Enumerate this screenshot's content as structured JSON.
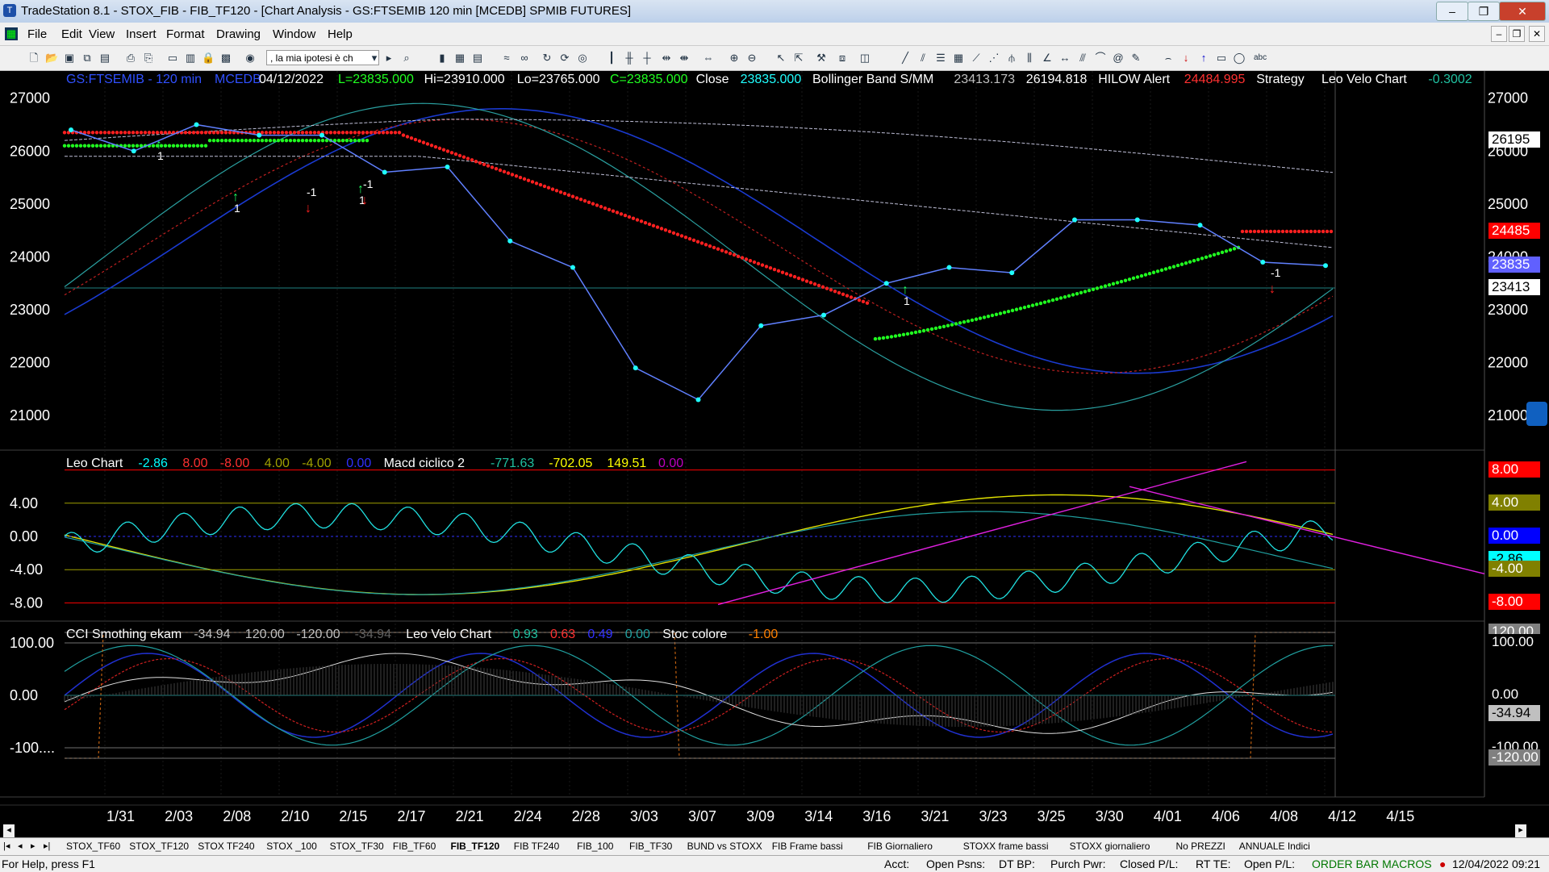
{
  "window": {
    "title": "TradeStation 8.1 - STOX_FIB - FIB_TF120 - [Chart Analysis - GS:FTSEMIB  120 min  [MCEDB] SPMIB FUTURES]",
    "minimize": "–",
    "restore": "❐",
    "close": "✕"
  },
  "menu": [
    "File",
    "Edit",
    "View",
    "Insert",
    "Format",
    "Drawing",
    "Window",
    "Help"
  ],
  "toolbar": {
    "combo_value": ", la mia ipotesi è ch"
  },
  "chart": {
    "header": {
      "symbol": "GS:FTSEMIB - 120 min",
      "feed": "MCEDB",
      "date": "04/12/2022",
      "last": "L=23835.000",
      "high": "Hi=23910.000",
      "low": "Lo=23765.000",
      "close_eq": "C=23835.000",
      "close_label": "Close",
      "close_value": "23835.000",
      "bb_label": "Bollinger Band S/MM",
      "bb_low": "23413.173",
      "bb_high": "26194.818",
      "hilow_label": "HILOW Alert",
      "hilow_value": "24484.995",
      "strategy_label": "Strategy",
      "velo_label": "Leo Velo Chart",
      "velo_value": "-0.3002"
    },
    "price_axis": [
      "27000",
      "26000",
      "25000",
      "24000",
      "23000",
      "22000",
      "21000"
    ],
    "price_badges": [
      {
        "text": "26195",
        "bg": "#ffffff",
        "fg": "#000000"
      },
      {
        "text": "24485",
        "bg": "#ff0000",
        "fg": "#ffffff"
      },
      {
        "text": "23835",
        "bg": "#6060ff",
        "fg": "#ffffff"
      },
      {
        "text": "23413",
        "bg": "#ffffff",
        "fg": "#000000"
      }
    ],
    "signals": [
      "1",
      "1",
      "-1",
      "1",
      "-1",
      "1",
      "-1"
    ],
    "dates": [
      "1/31",
      "2/03",
      "2/08",
      "2/10",
      "2/15",
      "2/17",
      "2/21",
      "2/24",
      "2/28",
      "3/03",
      "3/07",
      "3/09",
      "3/14",
      "3/16",
      "3/21",
      "3/23",
      "3/25",
      "3/30",
      "4/01",
      "4/06",
      "4/08",
      "4/12",
      "4/15"
    ]
  },
  "panel2": {
    "items": [
      {
        "text": "Leo Chart",
        "color": "#ffffff"
      },
      {
        "text": "-2.86",
        "color": "#00ffff"
      },
      {
        "text": "8.00",
        "color": "#ff3030"
      },
      {
        "text": "-8.00",
        "color": "#ff3030"
      },
      {
        "text": "4.00",
        "color": "#a0a000"
      },
      {
        "text": "-4.00",
        "color": "#a0a000"
      },
      {
        "text": "0.00",
        "color": "#3030ff"
      },
      {
        "text": "Macd ciclico 2",
        "color": "#ffffff"
      },
      {
        "text": "-771.63",
        "color": "#20c0a0"
      },
      {
        "text": "-702.05",
        "color": "#ffff00"
      },
      {
        "text": "149.51",
        "color": "#ffff00"
      },
      {
        "text": "0.00",
        "color": "#c000c0"
      }
    ],
    "axis": [
      "4.00",
      "0.00",
      "-4.00",
      "-8.00"
    ],
    "badges": [
      {
        "text": "8.00",
        "bg": "#ff0000",
        "fg": "#ffffff"
      },
      {
        "text": "4.00",
        "bg": "#808000",
        "fg": "#ffffff"
      },
      {
        "text": "0.00",
        "bg": "#0000ff",
        "fg": "#ffffff"
      },
      {
        "text": "-2.86",
        "bg": "#00ffff",
        "fg": "#000000"
      },
      {
        "text": "-4.00",
        "bg": "#808000",
        "fg": "#ffffff"
      },
      {
        "text": "-8.00",
        "bg": "#ff0000",
        "fg": "#ffffff"
      }
    ]
  },
  "panel3": {
    "items": [
      {
        "text": "CCI Smothing ekam",
        "color": "#ffffff"
      },
      {
        "text": "-34.94",
        "color": "#c0c0c0"
      },
      {
        "text": "120.00",
        "color": "#c0c0c0"
      },
      {
        "text": "-120.00",
        "color": "#c0c0c0"
      },
      {
        "text": "-34.94",
        "color": "#606060"
      },
      {
        "text": "Leo Velo Chart",
        "color": "#ffffff"
      },
      {
        "text": "0.93",
        "color": "#20c0a0"
      },
      {
        "text": "0.63",
        "color": "#ff3030"
      },
      {
        "text": "0.49",
        "color": "#3030ff"
      },
      {
        "text": "0.00",
        "color": "#20a0a0"
      },
      {
        "text": "Stoc colore",
        "color": "#ffffff"
      },
      {
        "text": "-1.00",
        "color": "#ff8000"
      }
    ],
    "axis": [
      "100.00",
      "0.00",
      "-100...."
    ],
    "badges": [
      {
        "text": "120.00",
        "bg": "#808080",
        "fg": "#ffffff"
      },
      {
        "text": "100.00",
        "bg": "#000000",
        "fg": "#ffffff"
      },
      {
        "text": "0.00",
        "bg": "#000000",
        "fg": "#ffffff"
      },
      {
        "text": "-34.94",
        "bg": "#c0c0c0",
        "fg": "#000000"
      },
      {
        "text": "-100.00",
        "bg": "#000000",
        "fg": "#ffffff"
      },
      {
        "text": "-120.00",
        "bg": "#808080",
        "fg": "#ffffff"
      }
    ]
  },
  "tabs": [
    "STOX_TF60",
    "STOX_TF120",
    "STOX TF240",
    "STOX _100",
    "STOX_TF30",
    "FIB_TF60",
    "FIB_TF120",
    "FIB TF240",
    "FIB_100",
    "FIB_TF30",
    "BUND vs STOXX",
    "FIB Frame bassi",
    "FIB Giornaliero",
    "STOXX frame bassi",
    "STOXX giornaliero",
    "No PREZZI",
    "ANNUALE Indici"
  ],
  "active_tab": "FIB_TF120",
  "status": {
    "help": "For Help, press F1",
    "acct": "Acct:",
    "open_psns": "Open Psns:",
    "dt_bp": "DT BP:",
    "purch_pwr": "Purch Pwr:",
    "closed_pl": "Closed P/L:",
    "rt_te": "RT TE:",
    "open_pl": "Open P/L:",
    "macros": "ORDER BAR  MACROS",
    "datetime": "12/04/2022 09:21"
  },
  "chart_data": {
    "type": "line",
    "x": [
      "1/31",
      "2/03",
      "2/08",
      "2/10",
      "2/15",
      "2/17",
      "2/21",
      "2/24",
      "2/28",
      "3/03",
      "3/07",
      "3/09",
      "3/14",
      "3/16",
      "3/21",
      "3/23",
      "3/25",
      "3/30",
      "4/01",
      "4/06",
      "4/08"
    ],
    "series": [
      {
        "name": "Close",
        "values": [
          26400,
          26000,
          26500,
          26300,
          26300,
          25600,
          25700,
          24300,
          23800,
          21900,
          21300,
          22700,
          22900,
          23500,
          23800,
          23700,
          24700,
          24700,
          24600,
          23900,
          23835
        ]
      }
    ],
    "ylim": [
      20500,
      27300
    ]
  }
}
